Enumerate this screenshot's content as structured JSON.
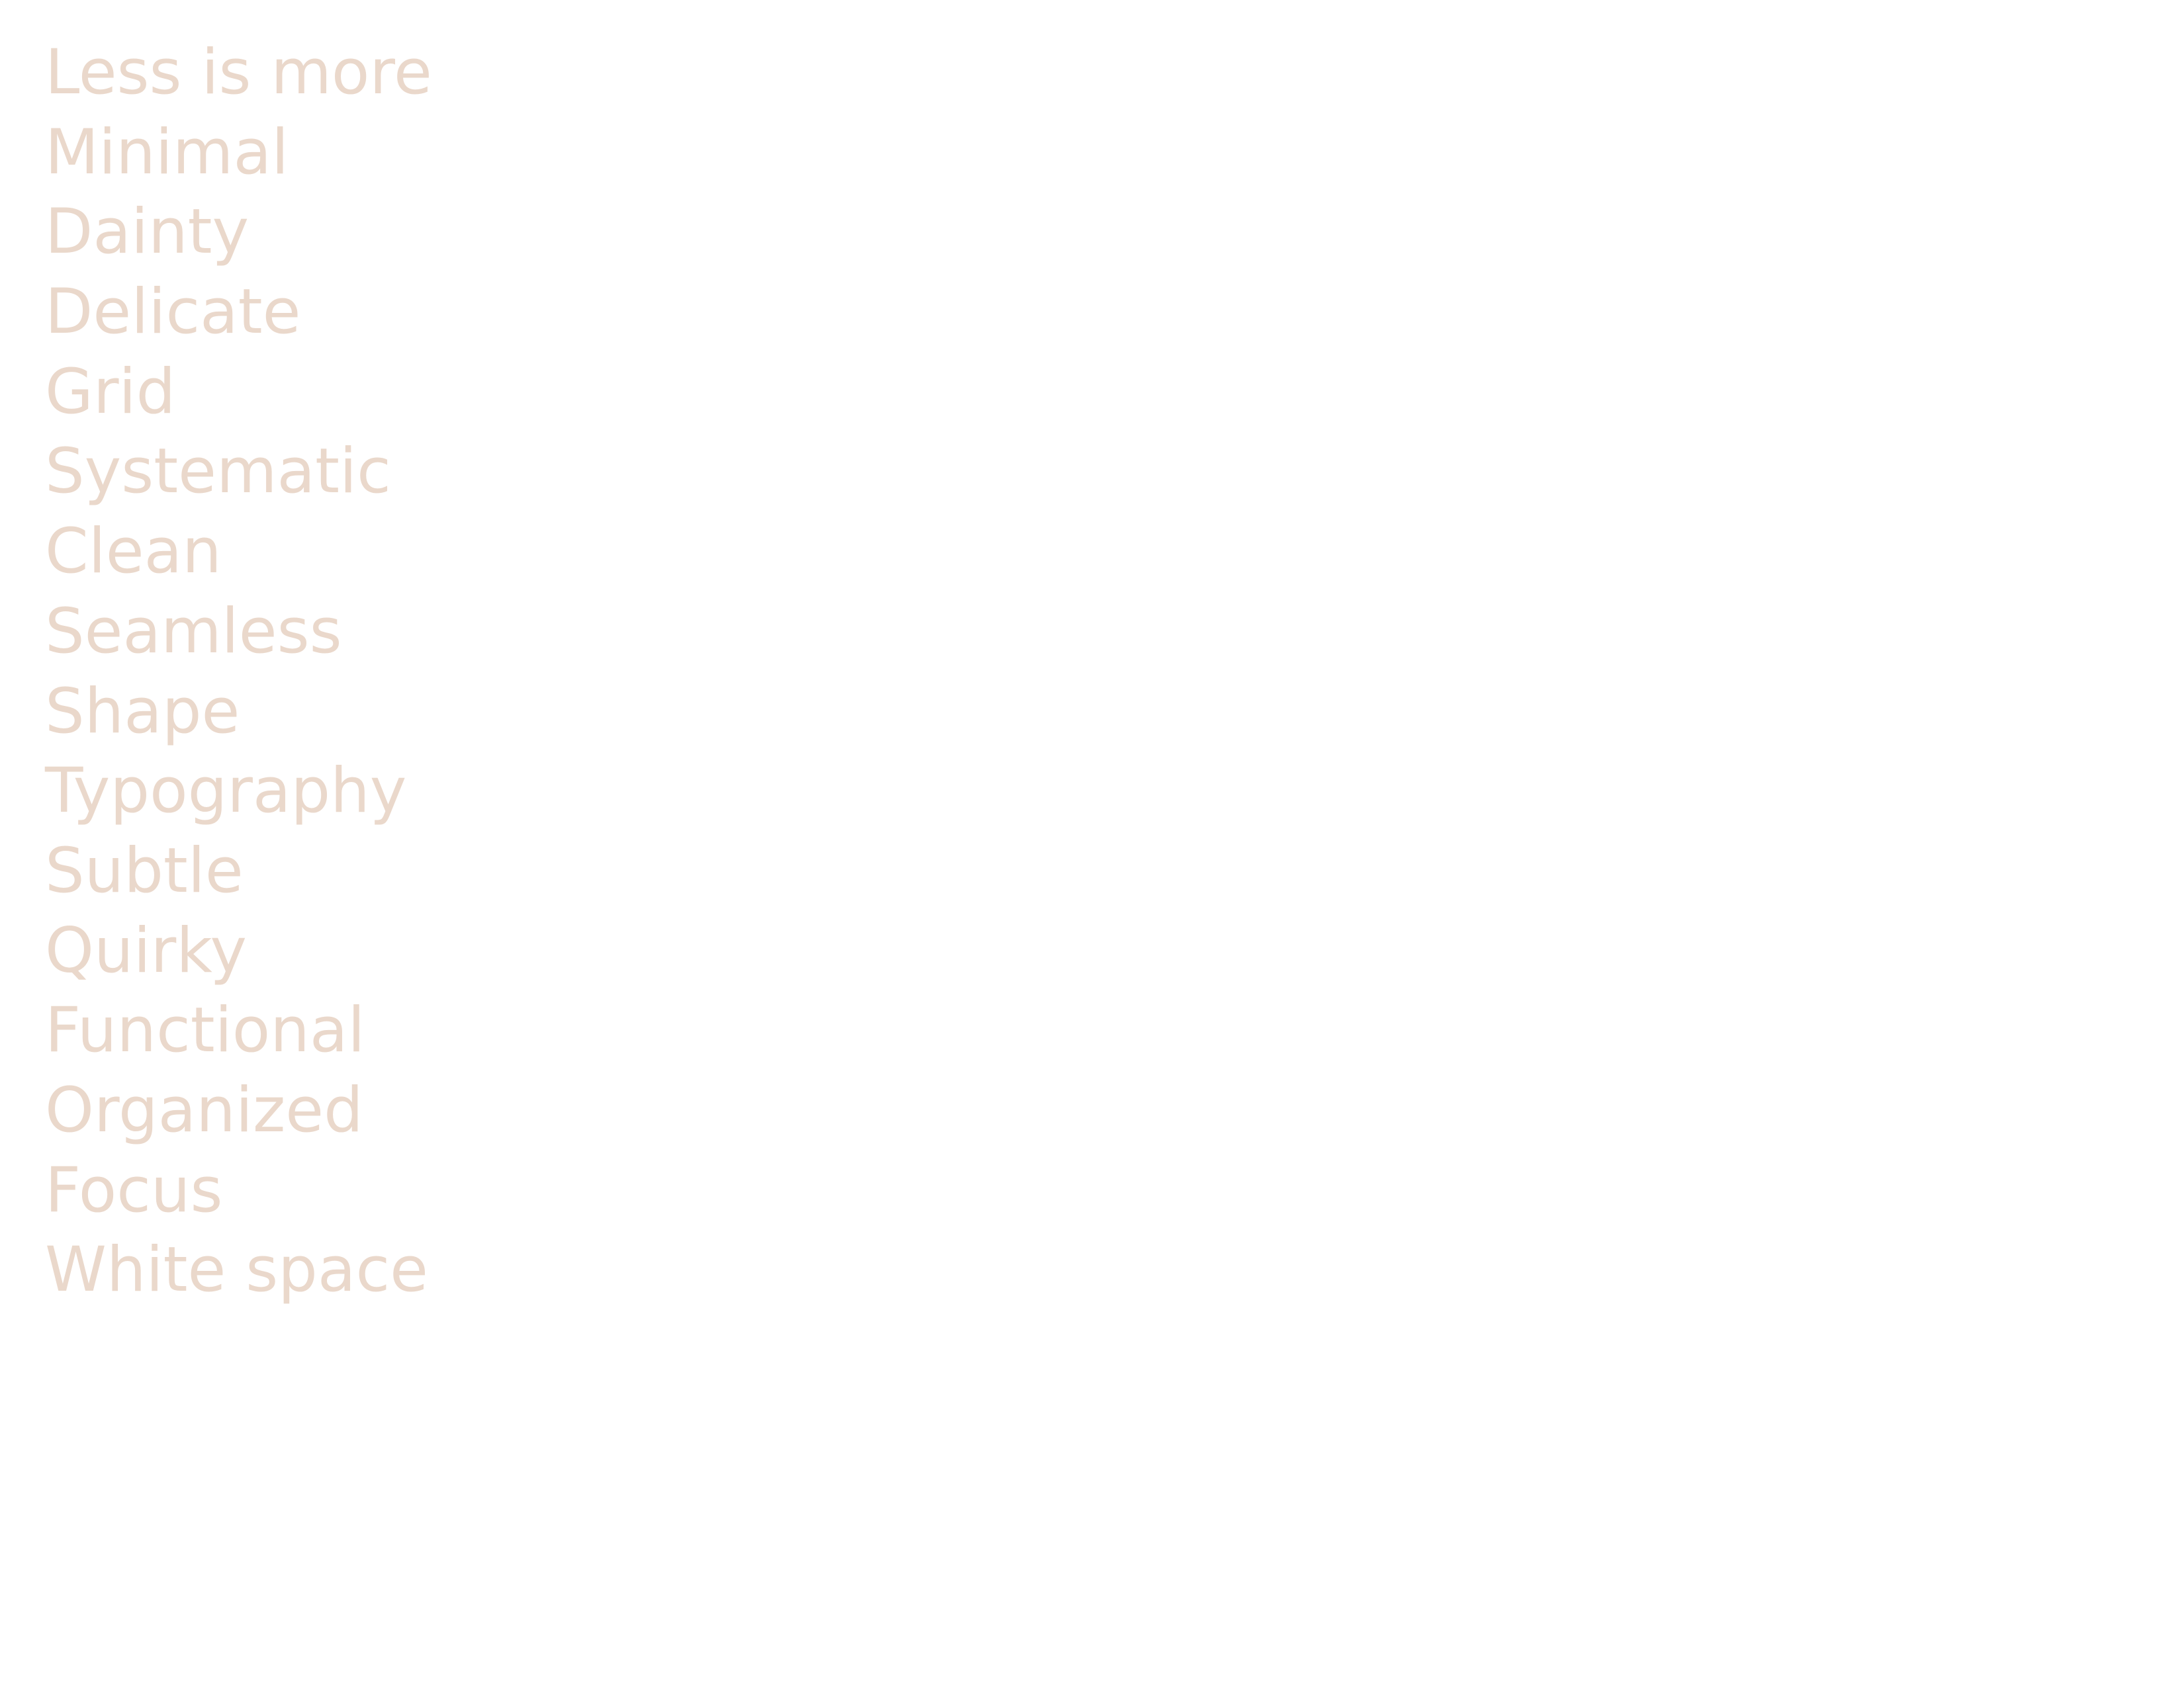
{
  "theme": {
    "text_color": "#ead8cb",
    "background_color": "#ffffff"
  },
  "words": [
    "Less is more",
    "Minimal",
    "Dainty",
    "Delicate",
    "Grid",
    "Systematic",
    "Clean",
    "Seamless",
    "Shape",
    "Typography",
    "Subtle",
    "Quirky",
    "Functional",
    "Organized",
    "Focus",
    "White space"
  ]
}
